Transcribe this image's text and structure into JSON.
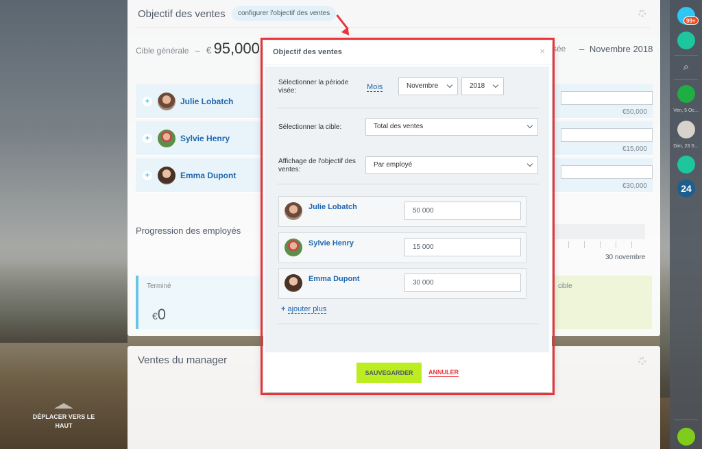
{
  "background": {
    "scroll_top_label": "DÉPLACER VERS LE HAUT"
  },
  "card": {
    "title": "Objectif des ventes",
    "config_link": "configurer l'objectif des ventes",
    "target_label": "Cible générale",
    "target_dash": "–",
    "target_currency": "€",
    "target_amount": "95,000",
    "period_suffix": "sée",
    "period_dash": "–",
    "period_month": "Novembre 2018",
    "employees": [
      {
        "name": "Julie Lobatch",
        "sum": "€50,000"
      },
      {
        "name": "Sylvie Henry",
        "sum": "€15,000"
      },
      {
        "name": "Emma Dupont",
        "sum": "€30,000"
      }
    ],
    "progress_label": "Progression des employés",
    "progress_date": "30 novembre",
    "done_label": "Terminé",
    "done_currency": "€",
    "done_value": "0",
    "target_box_label": "cible"
  },
  "card2": {
    "title": "Ventes du manager"
  },
  "rail": {
    "badge": "99+",
    "date1": "Ven, 5 Oc...",
    "date2": "Dim, 23 S...",
    "counter_24": "24"
  },
  "modal": {
    "title": "Objectif des ventes",
    "close": "×",
    "period_label": "Sélectionner la période visée:",
    "period_mode": "Mois",
    "month_value": "Novembre",
    "year_value": "2018",
    "target_label": "Sélectionner la cible:",
    "target_value": "Total des ventes",
    "display_label": "Affichage de l'objectif des ventes:",
    "display_value": "Par employé",
    "employees": [
      {
        "name": "Julie Lobatch",
        "value": "50 000"
      },
      {
        "name": "Sylvie Henry",
        "value": "15 000"
      },
      {
        "name": "Emma Dupont",
        "value": "30 000"
      }
    ],
    "add_more": "ajouter plus",
    "add_prefix": "+",
    "save": "SAUVEGARDER",
    "cancel": "ANNULER"
  },
  "colors": {
    "accent_blue": "#2067b0",
    "save_green": "#bbed21",
    "highlight_red": "#e8343a",
    "plus_blue": "#2fc6f6"
  }
}
